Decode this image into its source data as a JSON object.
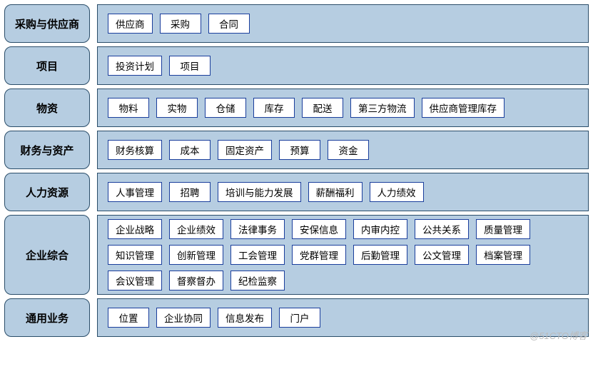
{
  "rows": [
    {
      "category": "采购与供应商",
      "items": [
        "供应商",
        "采购",
        "合同"
      ]
    },
    {
      "category": "项目",
      "items": [
        "投资计划",
        "项目"
      ]
    },
    {
      "category": "物资",
      "items": [
        "物料",
        "实物",
        "仓储",
        "库存",
        "配送",
        "第三方物流",
        "供应商管理库存"
      ]
    },
    {
      "category": "财务与资产",
      "items": [
        "财务核算",
        "成本",
        "固定资产",
        "预算",
        "资金"
      ]
    },
    {
      "category": "人力资源",
      "items": [
        "人事管理",
        "招聘",
        "培训与能力发展",
        "薪酬福利",
        "人力绩效"
      ]
    },
    {
      "category": "企业综合",
      "items": [
        "企业战略",
        "企业绩效",
        "法律事务",
        "安保信息",
        "内审内控",
        "公共关系",
        "质量管理",
        "知识管理",
        "创新管理",
        "工会管理",
        "党群管理",
        "后勤管理",
        "公文管理",
        "档案管理",
        "会议管理",
        "督察督办",
        "纪检监察"
      ]
    },
    {
      "category": "通用业务",
      "items": [
        "位置",
        "企业协同",
        "信息发布",
        "门户"
      ]
    }
  ],
  "watermark": "@51CTO博客"
}
